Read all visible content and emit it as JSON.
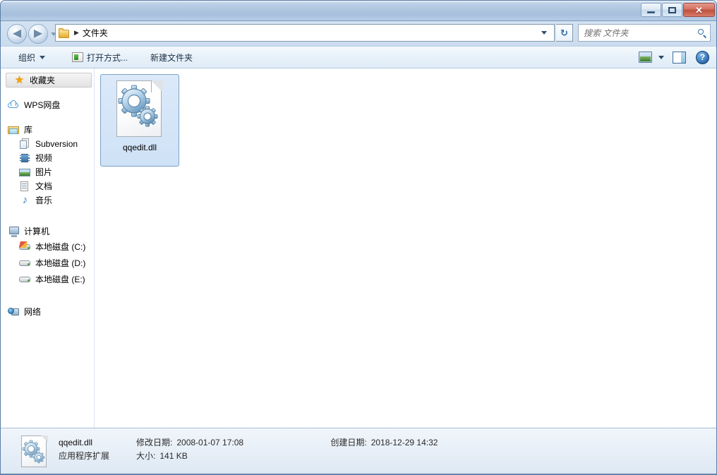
{
  "window": {
    "title": "",
    "controls": {
      "minimize_label": "最小化",
      "maximize_label": "最大化",
      "close_label": "关闭",
      "close_glyph": "✕"
    }
  },
  "addressbar": {
    "back_label": "返回",
    "forward_label": "前进",
    "back_glyph": "◀",
    "forward_glyph": "▶",
    "recent_label": "最近浏览的位置",
    "crumb_separator": "▶",
    "path_text": "文件夹",
    "refresh_glyph": "↻",
    "refresh_label": "刷新"
  },
  "search": {
    "placeholder": "搜索 文件夹",
    "icon": "search-icon"
  },
  "toolbar": {
    "organize_label": "组织",
    "openwith_label": "打开方式...",
    "newfolder_label": "新建文件夹",
    "view_label": "更改您的视图",
    "preview_pane_label": "显示预览窗格",
    "help_label": "获取帮助",
    "help_glyph": "?"
  },
  "sidebar": {
    "items": [
      {
        "label": "收藏夹",
        "icon": "star-icon",
        "level": "root",
        "selected": true
      },
      {
        "label": "WPS网盘",
        "icon": "cloud-icon",
        "level": "root",
        "selected": false
      },
      {
        "label": "库",
        "icon": "library-icon",
        "level": "root",
        "selected": false
      },
      {
        "label": "Subversion",
        "icon": "subversion-icon",
        "level": "child",
        "selected": false
      },
      {
        "label": "视频",
        "icon": "video-icon",
        "level": "child",
        "selected": false
      },
      {
        "label": "图片",
        "icon": "pictures-icon",
        "level": "child",
        "selected": false
      },
      {
        "label": "文档",
        "icon": "documents-icon",
        "level": "child",
        "selected": false
      },
      {
        "label": "音乐",
        "icon": "music-icon",
        "level": "child",
        "selected": false
      },
      {
        "label": "计算机",
        "icon": "computer-icon",
        "level": "root",
        "selected": false
      },
      {
        "label": "本地磁盘 (C:)",
        "icon": "system-drive-icon",
        "level": "child",
        "selected": false
      },
      {
        "label": "本地磁盘 (D:)",
        "icon": "drive-icon",
        "level": "child",
        "selected": false
      },
      {
        "label": "本地磁盘 (E:)",
        "icon": "drive-icon",
        "level": "child",
        "selected": false
      },
      {
        "label": "网络",
        "icon": "network-icon",
        "level": "root",
        "selected": false
      }
    ]
  },
  "content": {
    "files": [
      {
        "name": "qqedit.dll",
        "icon": "dll-gear-icon",
        "selected": true
      }
    ]
  },
  "details": {
    "file_name": "qqedit.dll",
    "file_type": "应用程序扩展",
    "modified_label": "修改日期:",
    "modified_value": "2008-01-07 17:08",
    "size_label": "大小:",
    "size_value": "141 KB",
    "created_label": "创建日期:",
    "created_value": "2018-12-29 14:32"
  },
  "colors": {
    "accent": "#3b6ea5",
    "selection": "#cfe2f6",
    "titlebar": "#b2c8e2",
    "close_button": "#be4f3c"
  }
}
